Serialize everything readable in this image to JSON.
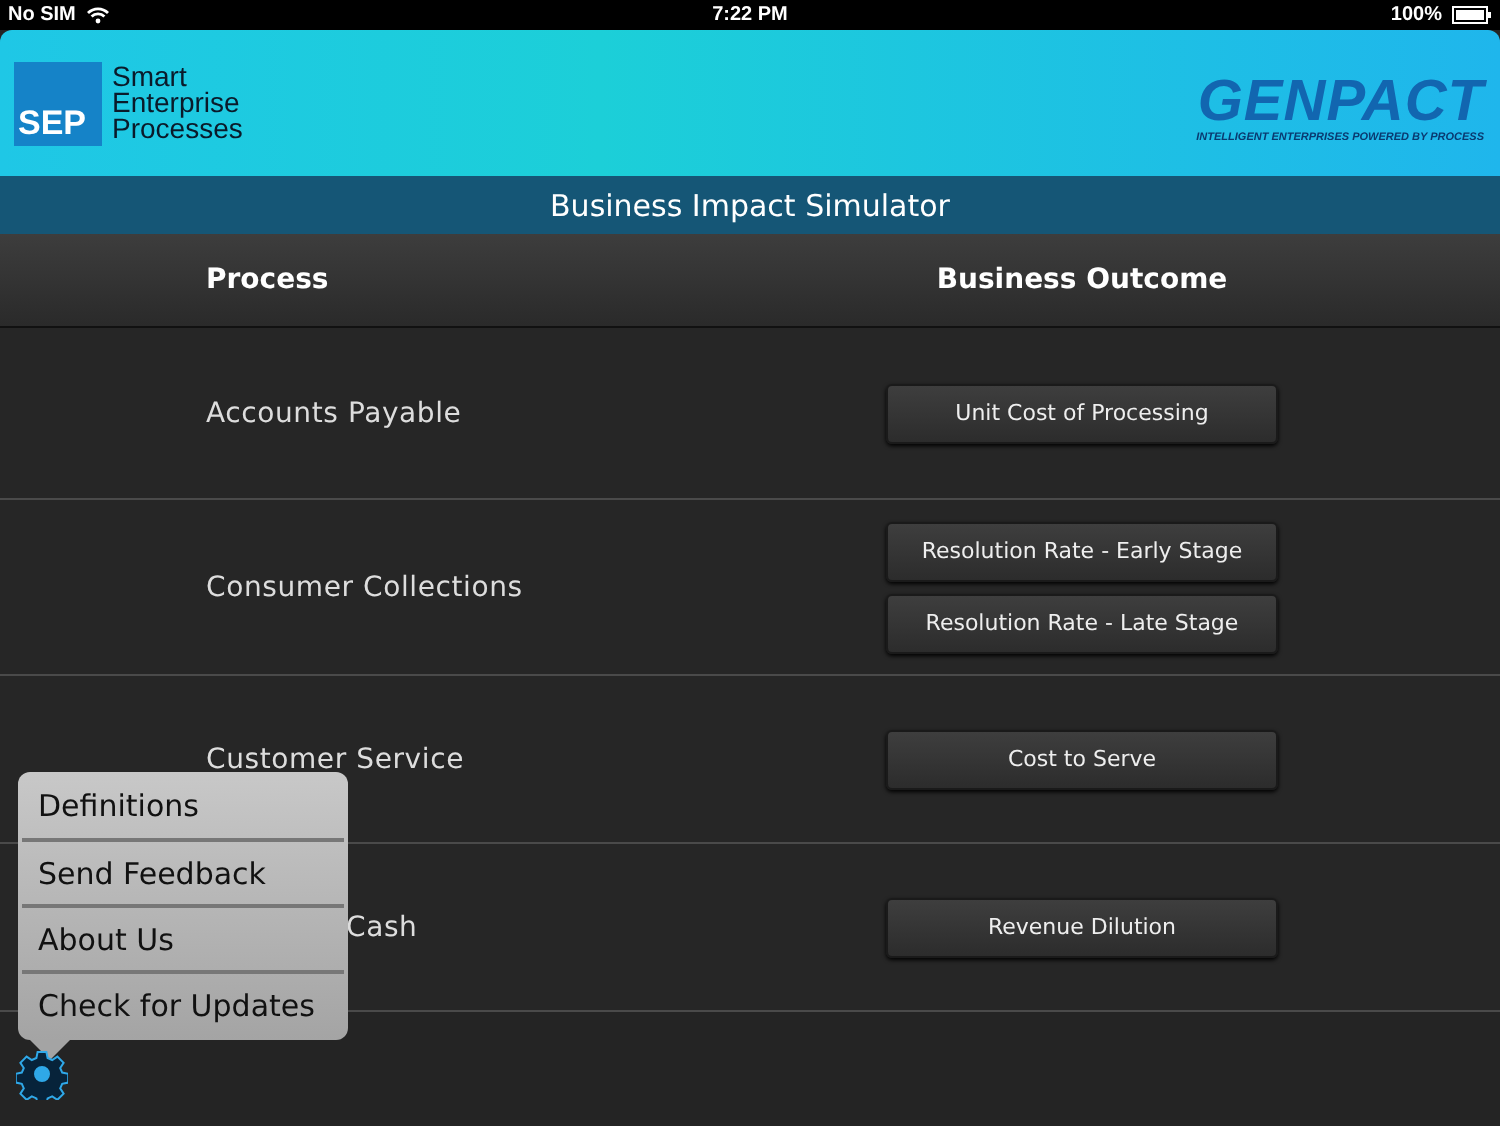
{
  "status_bar": {
    "carrier": "No SIM",
    "time": "7:22 PM",
    "battery": "100%"
  },
  "header": {
    "sep_badge": "SEP",
    "sep_name": [
      "Smart",
      "Enterprise",
      "Processes"
    ],
    "brand": "GENPACT",
    "tagline": "INTELLIGENT ENTERPRISES POWERED BY PROCESS"
  },
  "title": "Business Impact Simulator",
  "columns": [
    "Process",
    "Business Outcome"
  ],
  "rows": [
    {
      "process": "Accounts Payable",
      "kind": "full",
      "outcomes": [
        "Unit Cost of Processing"
      ]
    },
    {
      "process": "Consumer Collections",
      "kind": "full",
      "outcomes": [
        "Resolution Rate - Early Stage",
        "Resolution Rate - Late Stage"
      ]
    },
    {
      "process": "Customer Service",
      "kind": "full",
      "outcomes": [
        "Cost to Serve"
      ]
    },
    {
      "process": "Cash",
      "kind": "partial",
      "outcomes": [
        "Revenue Dilution"
      ]
    }
  ],
  "menu": [
    "Definitions",
    "Send Feedback",
    "About Us",
    "Check for Updates"
  ]
}
